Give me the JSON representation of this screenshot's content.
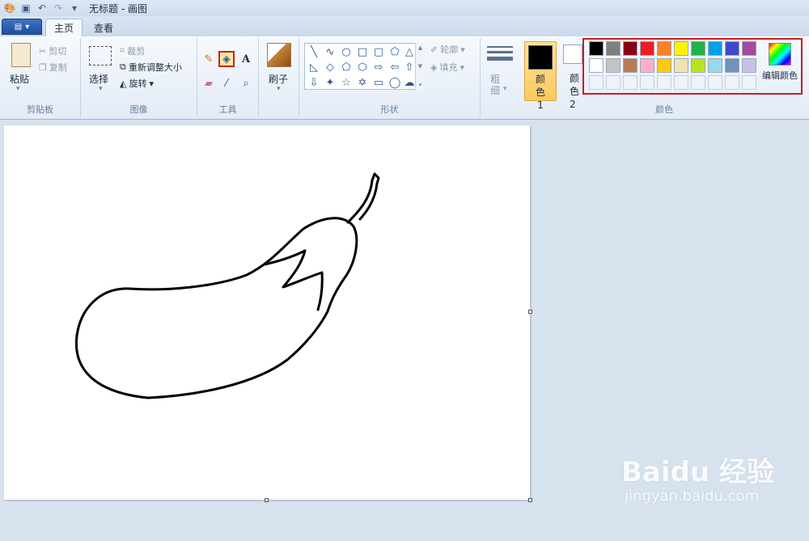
{
  "window": {
    "title": "无标题 - 画图"
  },
  "tabs": [
    {
      "label": "主页"
    },
    {
      "label": "查看"
    }
  ],
  "clipboard": {
    "paste": "粘贴",
    "cut": "剪切",
    "copy": "复制",
    "group": "剪贴板"
  },
  "image": {
    "select": "选择",
    "crop": "裁剪",
    "resize": "重新调整大小",
    "rotate": "旋转",
    "group": "图像"
  },
  "tools": {
    "group": "工具",
    "text_glyph": "A"
  },
  "brushes": {
    "label": "刷子"
  },
  "shapes": {
    "group": "形状",
    "outline": "轮廓",
    "fill": "填充"
  },
  "size": {
    "label": "粗细"
  },
  "colors": {
    "group": "颜色",
    "color1_label": "颜色 1",
    "color2_label": "颜色 2",
    "edit": "编辑颜色",
    "color1": "#000000",
    "color2": "#ffffff",
    "palette_row1": [
      "#000000",
      "#7f7f7f",
      "#880015",
      "#ed1c24",
      "#ff7f27",
      "#fff200",
      "#22b14c",
      "#00a2e8",
      "#3f48cc",
      "#a349a4"
    ],
    "palette_row2": [
      "#ffffff",
      "#c3c3c3",
      "#b97a57",
      "#ffaec9",
      "#ffc90e",
      "#efe4b0",
      "#b5e61d",
      "#99d9ea",
      "#7092be",
      "#c8bfe7"
    ]
  },
  "watermark": {
    "main": "Baidu 经验",
    "sub": "jingyan.baidu.com"
  }
}
